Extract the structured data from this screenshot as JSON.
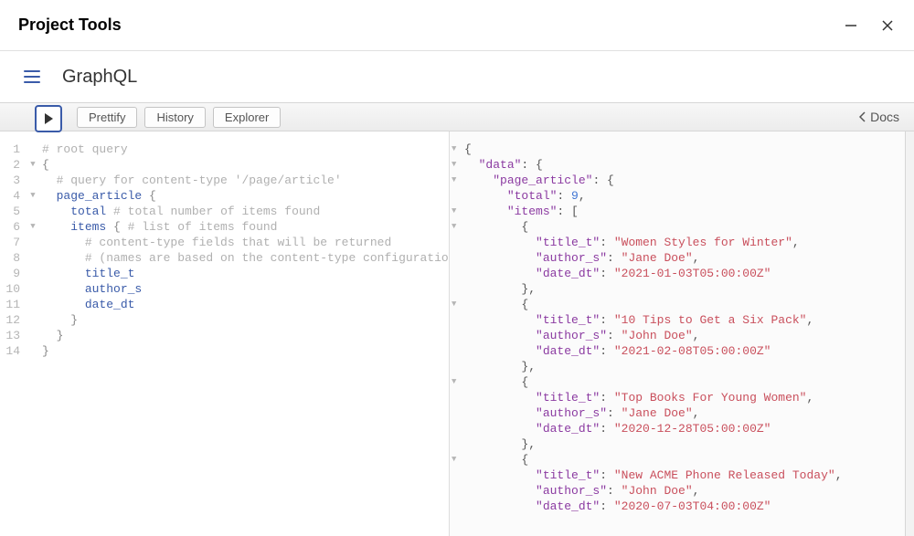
{
  "window": {
    "title": "Project Tools"
  },
  "header": {
    "page_title": "GraphQL"
  },
  "toolbar": {
    "prettify_label": "Prettify",
    "history_label": "History",
    "explorer_label": "Explorer",
    "docs_label": "Docs"
  },
  "query_lines": [
    {
      "no": 1,
      "fold": "",
      "tokens": [
        {
          "t": "# root query",
          "c": "c-comment"
        }
      ]
    },
    {
      "no": 2,
      "fold": "▼",
      "tokens": [
        {
          "t": "{",
          "c": "c-punct"
        }
      ]
    },
    {
      "no": 3,
      "fold": "",
      "tokens": [
        {
          "t": "  ",
          "c": ""
        },
        {
          "t": "# query for content-type '/page/article'",
          "c": "c-comment"
        }
      ]
    },
    {
      "no": 4,
      "fold": "▼",
      "tokens": [
        {
          "t": "  ",
          "c": ""
        },
        {
          "t": "page_article",
          "c": "c-prop"
        },
        {
          "t": " {",
          "c": "c-punct"
        }
      ]
    },
    {
      "no": 5,
      "fold": "",
      "tokens": [
        {
          "t": "    ",
          "c": ""
        },
        {
          "t": "total",
          "c": "c-prop"
        },
        {
          "t": " ",
          "c": ""
        },
        {
          "t": "# total number of items found",
          "c": "c-comment"
        }
      ]
    },
    {
      "no": 6,
      "fold": "▼",
      "tokens": [
        {
          "t": "    ",
          "c": ""
        },
        {
          "t": "items",
          "c": "c-prop"
        },
        {
          "t": " { ",
          "c": "c-punct"
        },
        {
          "t": "# list of items found",
          "c": "c-comment"
        }
      ]
    },
    {
      "no": 7,
      "fold": "",
      "tokens": [
        {
          "t": "      ",
          "c": ""
        },
        {
          "t": "# content-type fields that will be returned",
          "c": "c-comment"
        }
      ]
    },
    {
      "no": 8,
      "fold": "",
      "tokens": [
        {
          "t": "      ",
          "c": ""
        },
        {
          "t": "# (names are based on the content-type configuration)",
          "c": "c-comment"
        }
      ]
    },
    {
      "no": 9,
      "fold": "",
      "tokens": [
        {
          "t": "      ",
          "c": ""
        },
        {
          "t": "title_t",
          "c": "c-prop"
        }
      ]
    },
    {
      "no": 10,
      "fold": "",
      "tokens": [
        {
          "t": "      ",
          "c": ""
        },
        {
          "t": "author_s",
          "c": "c-prop"
        }
      ]
    },
    {
      "no": 11,
      "fold": "",
      "tokens": [
        {
          "t": "      ",
          "c": ""
        },
        {
          "t": "date_dt",
          "c": "c-prop"
        }
      ]
    },
    {
      "no": 12,
      "fold": "",
      "tokens": [
        {
          "t": "    }",
          "c": "c-punct"
        }
      ]
    },
    {
      "no": 13,
      "fold": "",
      "tokens": [
        {
          "t": "  }",
          "c": "c-punct"
        }
      ]
    },
    {
      "no": 14,
      "fold": "",
      "tokens": [
        {
          "t": "}",
          "c": "c-punct"
        }
      ]
    }
  ],
  "result_lines": [
    {
      "fold": "▼",
      "tokens": [
        {
          "t": "{",
          "c": "j-punct"
        }
      ]
    },
    {
      "fold": "▼",
      "tokens": [
        {
          "t": "  ",
          "c": ""
        },
        {
          "t": "\"data\"",
          "c": "j-key"
        },
        {
          "t": ": {",
          "c": "j-punct"
        }
      ]
    },
    {
      "fold": "▼",
      "tokens": [
        {
          "t": "    ",
          "c": ""
        },
        {
          "t": "\"page_article\"",
          "c": "j-key"
        },
        {
          "t": ": {",
          "c": "j-punct"
        }
      ]
    },
    {
      "fold": "",
      "tokens": [
        {
          "t": "      ",
          "c": ""
        },
        {
          "t": "\"total\"",
          "c": "j-key"
        },
        {
          "t": ": ",
          "c": "j-punct"
        },
        {
          "t": "9",
          "c": "j-num"
        },
        {
          "t": ",",
          "c": "j-punct"
        }
      ]
    },
    {
      "fold": "▼",
      "tokens": [
        {
          "t": "      ",
          "c": ""
        },
        {
          "t": "\"items\"",
          "c": "j-key"
        },
        {
          "t": ": [",
          "c": "j-punct"
        }
      ]
    },
    {
      "fold": "▼",
      "tokens": [
        {
          "t": "        ",
          "c": ""
        },
        {
          "t": "{",
          "c": "j-punct"
        }
      ]
    },
    {
      "fold": "",
      "tokens": [
        {
          "t": "          ",
          "c": ""
        },
        {
          "t": "\"title_t\"",
          "c": "j-key"
        },
        {
          "t": ": ",
          "c": "j-punct"
        },
        {
          "t": "\"Women Styles for Winter\"",
          "c": "j-str"
        },
        {
          "t": ",",
          "c": "j-punct"
        }
      ]
    },
    {
      "fold": "",
      "tokens": [
        {
          "t": "          ",
          "c": ""
        },
        {
          "t": "\"author_s\"",
          "c": "j-key"
        },
        {
          "t": ": ",
          "c": "j-punct"
        },
        {
          "t": "\"Jane Doe\"",
          "c": "j-str"
        },
        {
          "t": ",",
          "c": "j-punct"
        }
      ]
    },
    {
      "fold": "",
      "tokens": [
        {
          "t": "          ",
          "c": ""
        },
        {
          "t": "\"date_dt\"",
          "c": "j-key"
        },
        {
          "t": ": ",
          "c": "j-punct"
        },
        {
          "t": "\"2021-01-03T05:00:00Z\"",
          "c": "j-str"
        }
      ]
    },
    {
      "fold": "",
      "tokens": [
        {
          "t": "        ",
          "c": ""
        },
        {
          "t": "},",
          "c": "j-punct"
        }
      ]
    },
    {
      "fold": "▼",
      "tokens": [
        {
          "t": "        ",
          "c": ""
        },
        {
          "t": "{",
          "c": "j-punct"
        }
      ]
    },
    {
      "fold": "",
      "tokens": [
        {
          "t": "          ",
          "c": ""
        },
        {
          "t": "\"title_t\"",
          "c": "j-key"
        },
        {
          "t": ": ",
          "c": "j-punct"
        },
        {
          "t": "\"10 Tips to Get a Six Pack\"",
          "c": "j-str"
        },
        {
          "t": ",",
          "c": "j-punct"
        }
      ]
    },
    {
      "fold": "",
      "tokens": [
        {
          "t": "          ",
          "c": ""
        },
        {
          "t": "\"author_s\"",
          "c": "j-key"
        },
        {
          "t": ": ",
          "c": "j-punct"
        },
        {
          "t": "\"John Doe\"",
          "c": "j-str"
        },
        {
          "t": ",",
          "c": "j-punct"
        }
      ]
    },
    {
      "fold": "",
      "tokens": [
        {
          "t": "          ",
          "c": ""
        },
        {
          "t": "\"date_dt\"",
          "c": "j-key"
        },
        {
          "t": ": ",
          "c": "j-punct"
        },
        {
          "t": "\"2021-02-08T05:00:00Z\"",
          "c": "j-str"
        }
      ]
    },
    {
      "fold": "",
      "tokens": [
        {
          "t": "        ",
          "c": ""
        },
        {
          "t": "},",
          "c": "j-punct"
        }
      ]
    },
    {
      "fold": "▼",
      "tokens": [
        {
          "t": "        ",
          "c": ""
        },
        {
          "t": "{",
          "c": "j-punct"
        }
      ]
    },
    {
      "fold": "",
      "tokens": [
        {
          "t": "          ",
          "c": ""
        },
        {
          "t": "\"title_t\"",
          "c": "j-key"
        },
        {
          "t": ": ",
          "c": "j-punct"
        },
        {
          "t": "\"Top Books For Young Women\"",
          "c": "j-str"
        },
        {
          "t": ",",
          "c": "j-punct"
        }
      ]
    },
    {
      "fold": "",
      "tokens": [
        {
          "t": "          ",
          "c": ""
        },
        {
          "t": "\"author_s\"",
          "c": "j-key"
        },
        {
          "t": ": ",
          "c": "j-punct"
        },
        {
          "t": "\"Jane Doe\"",
          "c": "j-str"
        },
        {
          "t": ",",
          "c": "j-punct"
        }
      ]
    },
    {
      "fold": "",
      "tokens": [
        {
          "t": "          ",
          "c": ""
        },
        {
          "t": "\"date_dt\"",
          "c": "j-key"
        },
        {
          "t": ": ",
          "c": "j-punct"
        },
        {
          "t": "\"2020-12-28T05:00:00Z\"",
          "c": "j-str"
        }
      ]
    },
    {
      "fold": "",
      "tokens": [
        {
          "t": "        ",
          "c": ""
        },
        {
          "t": "},",
          "c": "j-punct"
        }
      ]
    },
    {
      "fold": "▼",
      "tokens": [
        {
          "t": "        ",
          "c": ""
        },
        {
          "t": "{",
          "c": "j-punct"
        }
      ]
    },
    {
      "fold": "",
      "tokens": [
        {
          "t": "          ",
          "c": ""
        },
        {
          "t": "\"title_t\"",
          "c": "j-key"
        },
        {
          "t": ": ",
          "c": "j-punct"
        },
        {
          "t": "\"New ACME Phone Released Today\"",
          "c": "j-str"
        },
        {
          "t": ",",
          "c": "j-punct"
        }
      ]
    },
    {
      "fold": "",
      "tokens": [
        {
          "t": "          ",
          "c": ""
        },
        {
          "t": "\"author_s\"",
          "c": "j-key"
        },
        {
          "t": ": ",
          "c": "j-punct"
        },
        {
          "t": "\"John Doe\"",
          "c": "j-str"
        },
        {
          "t": ",",
          "c": "j-punct"
        }
      ]
    },
    {
      "fold": "",
      "tokens": [
        {
          "t": "          ",
          "c": ""
        },
        {
          "t": "\"date_dt\"",
          "c": "j-key"
        },
        {
          "t": ": ",
          "c": "j-punct"
        },
        {
          "t": "\"2020-07-03T04:00:00Z\"",
          "c": "j-str"
        }
      ]
    }
  ]
}
